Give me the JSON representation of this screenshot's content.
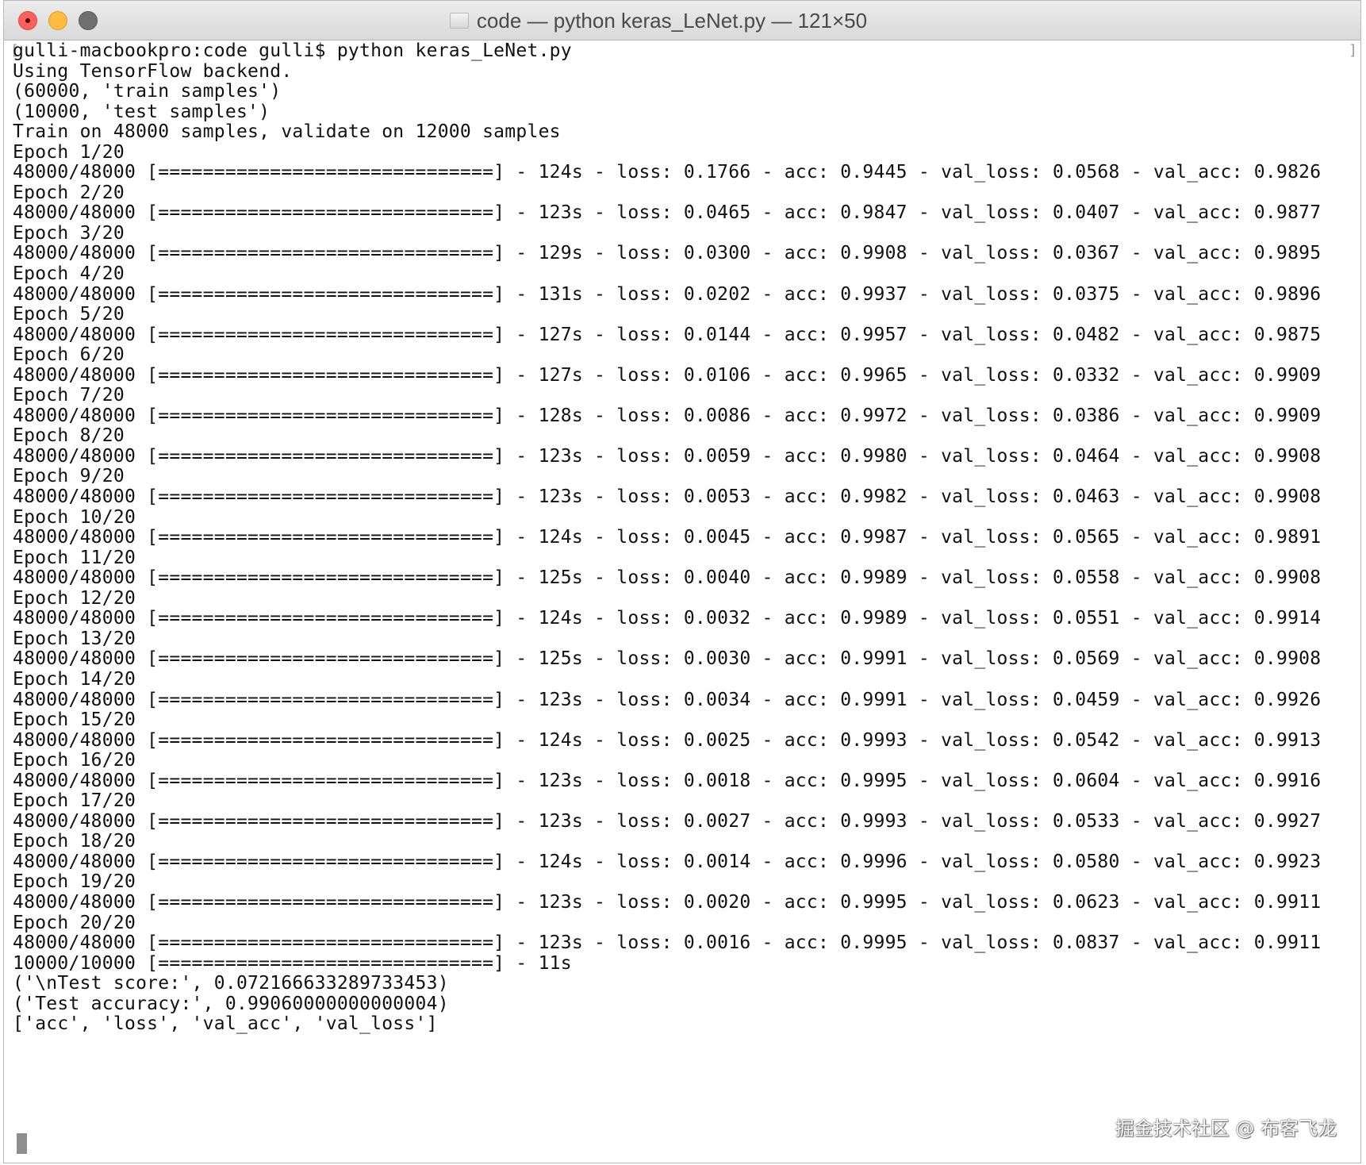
{
  "window": {
    "title": "code — python keras_LeNet.py — 121×50"
  },
  "terminal": {
    "lines": [
      "gulli-macbookpro:code gulli$ python keras_LeNet.py",
      "Using TensorFlow backend.",
      "(60000, 'train samples')",
      "(10000, 'test samples')",
      "Train on 48000 samples, validate on 12000 samples",
      "Epoch 1/20",
      "48000/48000 [==============================] - 124s - loss: 0.1766 - acc: 0.9445 - val_loss: 0.0568 - val_acc: 0.9826",
      "Epoch 2/20",
      "48000/48000 [==============================] - 123s - loss: 0.0465 - acc: 0.9847 - val_loss: 0.0407 - val_acc: 0.9877",
      "Epoch 3/20",
      "48000/48000 [==============================] - 129s - loss: 0.0300 - acc: 0.9908 - val_loss: 0.0367 - val_acc: 0.9895",
      "Epoch 4/20",
      "48000/48000 [==============================] - 131s - loss: 0.0202 - acc: 0.9937 - val_loss: 0.0375 - val_acc: 0.9896",
      "Epoch 5/20",
      "48000/48000 [==============================] - 127s - loss: 0.0144 - acc: 0.9957 - val_loss: 0.0482 - val_acc: 0.9875",
      "Epoch 6/20",
      "48000/48000 [==============================] - 127s - loss: 0.0106 - acc: 0.9965 - val_loss: 0.0332 - val_acc: 0.9909",
      "Epoch 7/20",
      "48000/48000 [==============================] - 128s - loss: 0.0086 - acc: 0.9972 - val_loss: 0.0386 - val_acc: 0.9909",
      "Epoch 8/20",
      "48000/48000 [==============================] - 123s - loss: 0.0059 - acc: 0.9980 - val_loss: 0.0464 - val_acc: 0.9908",
      "Epoch 9/20",
      "48000/48000 [==============================] - 123s - loss: 0.0053 - acc: 0.9982 - val_loss: 0.0463 - val_acc: 0.9908",
      "Epoch 10/20",
      "48000/48000 [==============================] - 124s - loss: 0.0045 - acc: 0.9987 - val_loss: 0.0565 - val_acc: 0.9891",
      "Epoch 11/20",
      "48000/48000 [==============================] - 125s - loss: 0.0040 - acc: 0.9989 - val_loss: 0.0558 - val_acc: 0.9908",
      "Epoch 12/20",
      "48000/48000 [==============================] - 124s - loss: 0.0032 - acc: 0.9989 - val_loss: 0.0551 - val_acc: 0.9914",
      "Epoch 13/20",
      "48000/48000 [==============================] - 125s - loss: 0.0030 - acc: 0.9991 - val_loss: 0.0569 - val_acc: 0.9908",
      "Epoch 14/20",
      "48000/48000 [==============================] - 123s - loss: 0.0034 - acc: 0.9991 - val_loss: 0.0459 - val_acc: 0.9926",
      "Epoch 15/20",
      "48000/48000 [==============================] - 124s - loss: 0.0025 - acc: 0.9993 - val_loss: 0.0542 - val_acc: 0.9913",
      "Epoch 16/20",
      "48000/48000 [==============================] - 123s - loss: 0.0018 - acc: 0.9995 - val_loss: 0.0604 - val_acc: 0.9916",
      "Epoch 17/20",
      "48000/48000 [==============================] - 123s - loss: 0.0027 - acc: 0.9993 - val_loss: 0.0533 - val_acc: 0.9927",
      "Epoch 18/20",
      "48000/48000 [==============================] - 124s - loss: 0.0014 - acc: 0.9996 - val_loss: 0.0580 - val_acc: 0.9923",
      "Epoch 19/20",
      "48000/48000 [==============================] - 123s - loss: 0.0020 - acc: 0.9995 - val_loss: 0.0623 - val_acc: 0.9911",
      "Epoch 20/20",
      "48000/48000 [==============================] - 123s - loss: 0.0016 - acc: 0.9995 - val_loss: 0.0837 - val_acc: 0.9911",
      "10000/10000 [==============================] - 11s",
      "('\\nTest score:', 0.072166633289733453)",
      "('Test accuracy:', 0.99060000000000004)",
      "['acc', 'loss', 'val_acc', 'val_loss']"
    ]
  },
  "watermark": "掘金技术社区 @ 布客飞龙",
  "colors": {
    "close": "#fc605c",
    "minimize": "#fdbc40",
    "zoom": "#6f6f6f",
    "text": "#111111",
    "cursor": "#8e8e8e"
  },
  "icons": {
    "close": "close-button-icon",
    "minimize": "minimize-button-icon",
    "zoom": "zoom-button-icon",
    "document": "document-icon"
  }
}
